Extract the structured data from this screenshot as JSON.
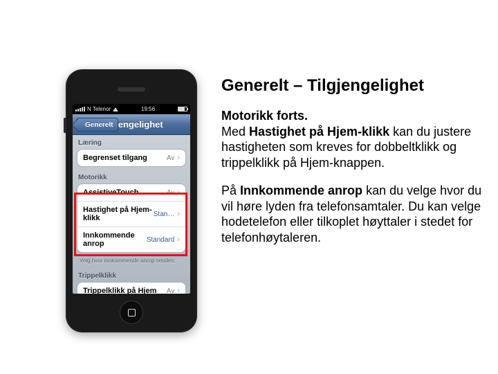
{
  "title": "Generelt – Tilgjengelighet",
  "paragraph1": {
    "lead_bold": "Motorikk forts.",
    "pre": "Med ",
    "bold": "Hastighet på Hjem-klikk",
    "post": " kan du justere hastigheten som kreves for dobbeltklikk og trippelklikk på Hjem-knappen."
  },
  "paragraph2": {
    "pre": "På ",
    "bold": "Innkommende anrop",
    "post": " kan du velge hvor du vil høre lyden fra telefonsamtaler. Du kan velge hodetelefon eller tilkoplet høyttaler i stedet for telefonhøytaleren."
  },
  "phone": {
    "status": {
      "carrier": "N Telenor",
      "time": "19:56"
    },
    "nav": {
      "back": "Generelt",
      "title": "Tilgjengelighet"
    },
    "sections": {
      "learning": {
        "header": "Læring",
        "restricted_label": "Begrenset tilgang",
        "restricted_value": "Av"
      },
      "motor": {
        "header": "Motorikk",
        "assistive_label": "AssistiveTouch",
        "assistive_value": "Av",
        "homespeed_label": "Hastighet på Hjem-klikk",
        "homespeed_value": "Stan…",
        "incoming_label": "Innkommende anrop",
        "incoming_value": "Standard",
        "footnote": "Velg hvor innkommende anrop sendes."
      },
      "triple": {
        "header": "Trippelklikk",
        "label": "Trippelklikk på Hjem",
        "value": "Av"
      }
    }
  }
}
